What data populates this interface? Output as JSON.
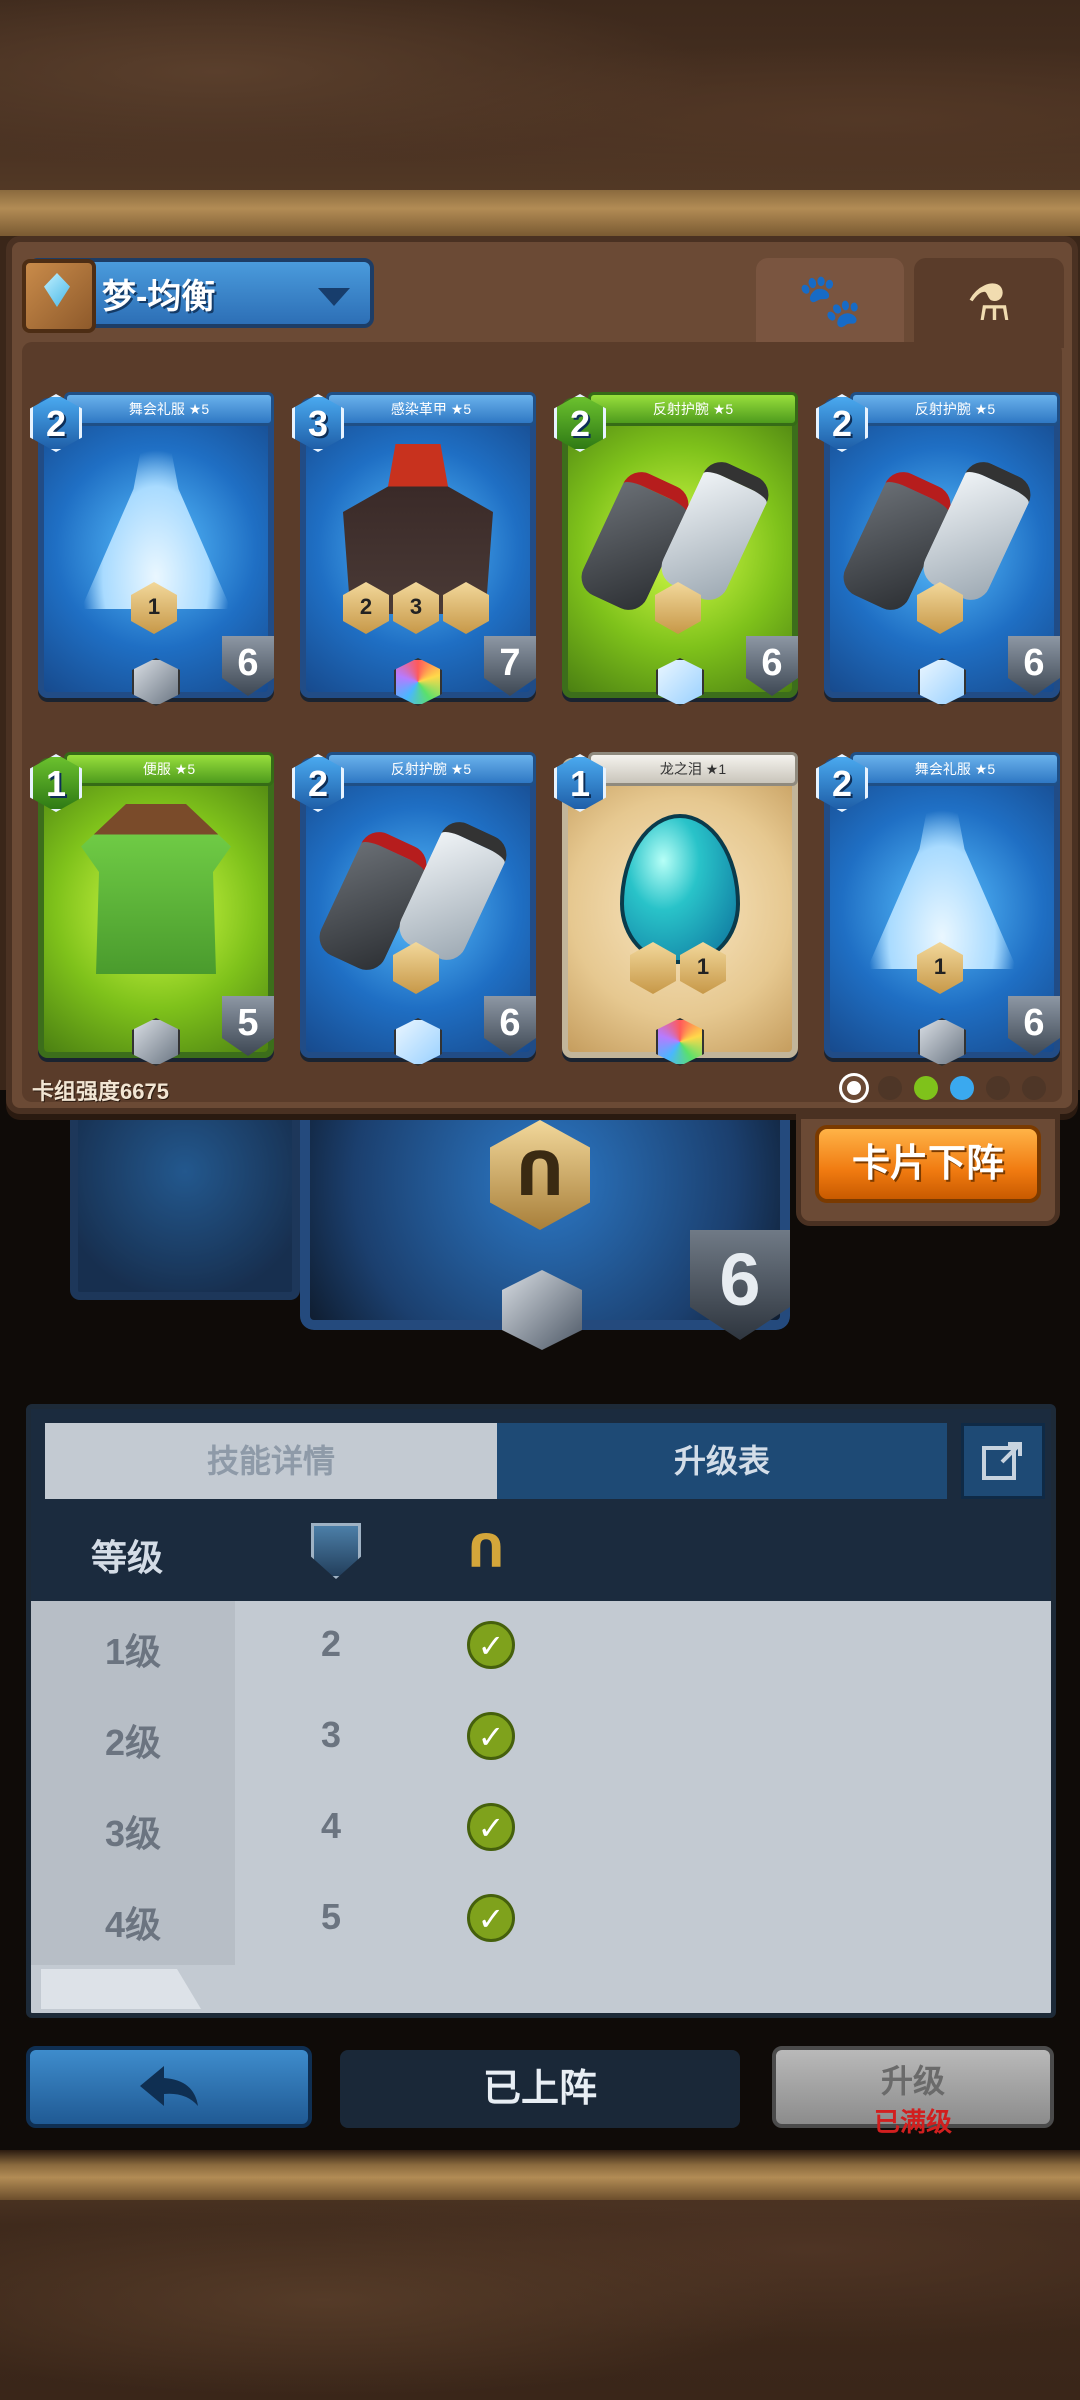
{
  "deck": {
    "name": "梦-均衡",
    "power_label": "卡组强度6675"
  },
  "cards": [
    {
      "title": "舞会礼服 ★5",
      "cost": "2",
      "level": "6",
      "theme": "blue",
      "art": "dress",
      "badges": [
        "1"
      ]
    },
    {
      "title": "感染革甲 ★5",
      "cost": "3",
      "level": "7",
      "theme": "blue",
      "art": "armor",
      "badges": [
        "2",
        "3",
        ""
      ]
    },
    {
      "title": "反射护腕 ★5",
      "cost": "2",
      "level": "6",
      "theme": "green",
      "art": "bracers",
      "badges": [
        ""
      ]
    },
    {
      "title": "反射护腕 ★5",
      "cost": "2",
      "level": "6",
      "theme": "blue",
      "art": "bracers",
      "badges": [
        ""
      ]
    },
    {
      "title": "便服 ★5",
      "cost": "1",
      "level": "5",
      "theme": "green",
      "art": "tunic",
      "badges": []
    },
    {
      "title": "反射护腕 ★5",
      "cost": "2",
      "level": "6",
      "theme": "blue",
      "art": "bracers",
      "badges": [
        ""
      ]
    },
    {
      "title": "龙之泪 ★1",
      "cost": "1",
      "level": "",
      "theme": "tan",
      "art": "egg",
      "badges": [
        "",
        "1"
      ]
    },
    {
      "title": "舞会礼服 ★5",
      "cost": "2",
      "level": "6",
      "theme": "blue",
      "art": "dress",
      "badges": [
        "1"
      ]
    }
  ],
  "actions": {
    "unequip": "卡片下阵",
    "equipped": "已上阵",
    "upgrade": "升级",
    "upgrade_status": "已满级"
  },
  "preview": {
    "level": "6"
  },
  "detail": {
    "tab_skill": "技能详情",
    "tab_upgrade": "升级表",
    "col_level": "等级",
    "rows": [
      {
        "level": "1级",
        "value": "2"
      },
      {
        "level": "2级",
        "value": "3"
      },
      {
        "level": "3级",
        "value": "4"
      },
      {
        "level": "4级",
        "value": "5"
      }
    ]
  },
  "colors": {
    "accent_orange": "#f07a10",
    "panel_blue": "#1e4a75",
    "check_green": "#7fa21c"
  },
  "icons": [
    "book-icon",
    "paw-icon",
    "potion-icon",
    "shield-icon",
    "bind-icon",
    "external-link-icon",
    "back-arrow-icon",
    "check-icon"
  ]
}
